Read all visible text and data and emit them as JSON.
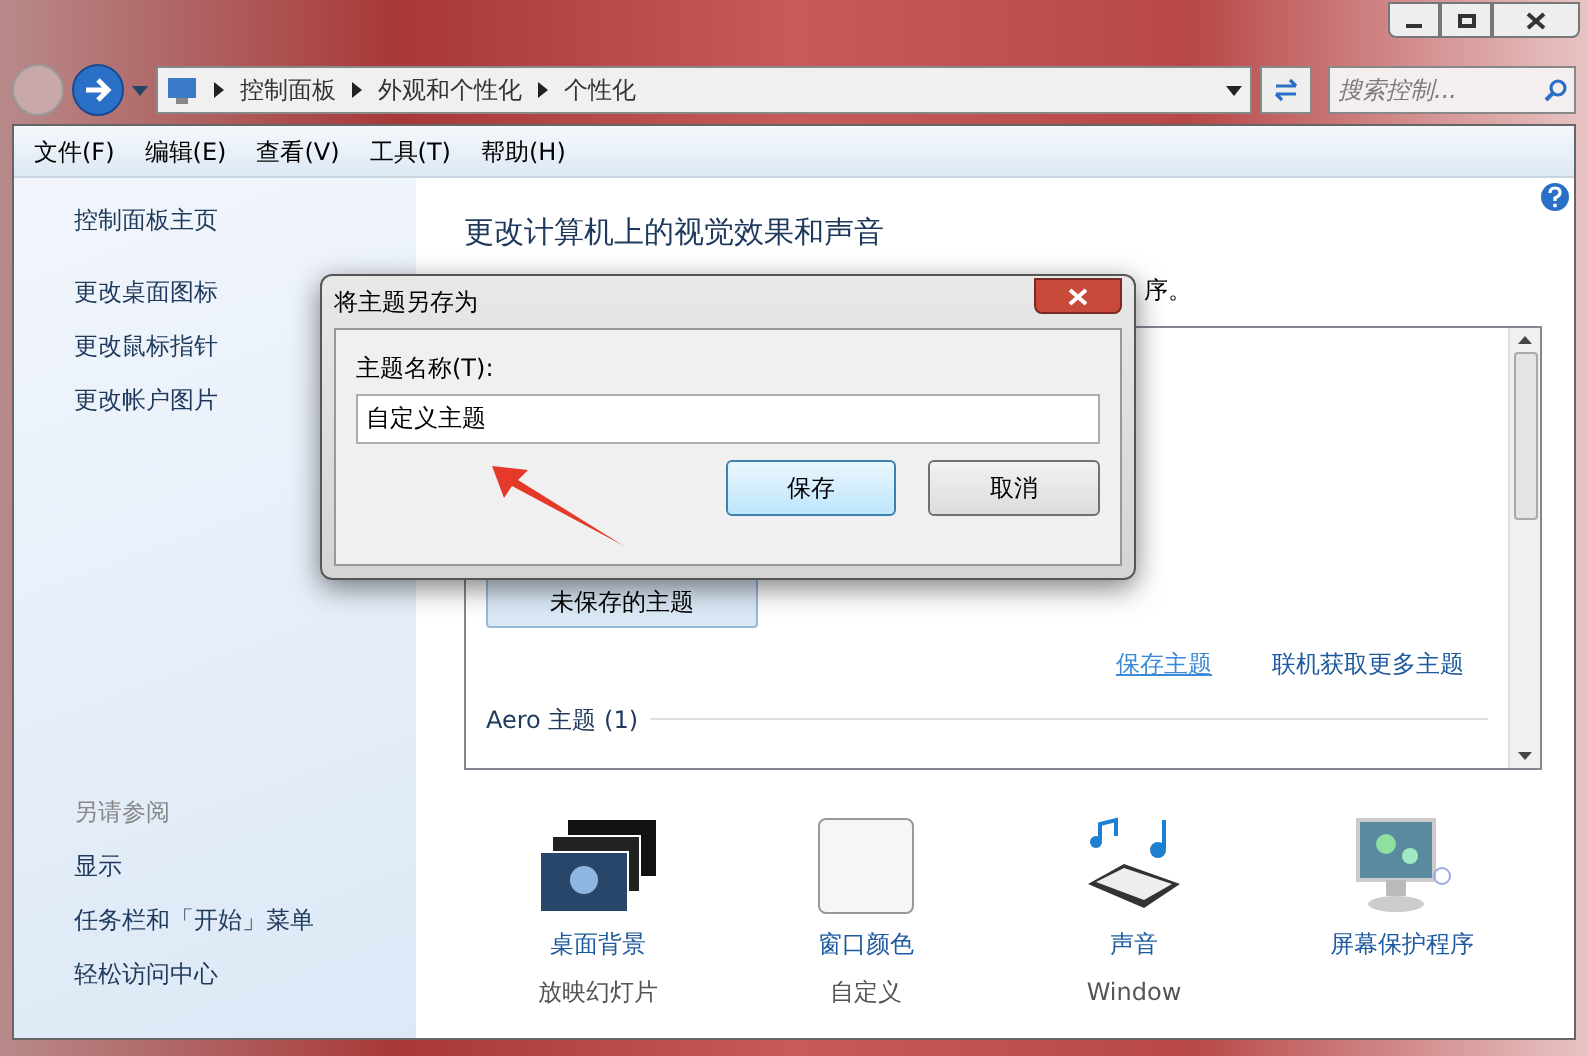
{
  "address_bar": {
    "breadcrumbs": [
      "控制面板",
      "外观和个性化",
      "个性化"
    ]
  },
  "search": {
    "placeholder": "搜索控制..."
  },
  "menu": [
    "文件(F)",
    "编辑(E)",
    "查看(V)",
    "工具(T)",
    "帮助(H)"
  ],
  "sidebar": {
    "items": [
      "控制面板主页",
      "更改桌面图标",
      "更改鼠标指针",
      "更改帐户图片"
    ],
    "see_also_title": "另请参阅",
    "see_also": [
      "显示",
      "任务栏和「开始」菜单",
      "轻松访问中心"
    ]
  },
  "main": {
    "title": "更改计算机上的视觉效果和声音",
    "subtitle_tail": "序。",
    "theme_list": {
      "unsaved_theme": "未保存的主题",
      "links": [
        {
          "label": "保存主题",
          "hovered": true
        },
        {
          "label": "联机获取更多主题",
          "hovered": false
        }
      ],
      "group": "Aero 主题 (1)"
    },
    "settings": [
      {
        "kind": "background",
        "label": "桌面背景",
        "value": "放映幻灯片"
      },
      {
        "kind": "color",
        "label": "窗口颜色",
        "value": "自定义"
      },
      {
        "kind": "sound",
        "label": "声音",
        "value": "Window"
      },
      {
        "kind": "screensaver",
        "label": "屏幕保护程序"
      }
    ]
  },
  "dialog": {
    "title": "将主题另存为",
    "field_label": "主题名称(T):",
    "field_value": "自定义主题",
    "buttons": [
      {
        "label": "保存",
        "default": true
      },
      {
        "label": "取消",
        "default": false
      }
    ]
  }
}
